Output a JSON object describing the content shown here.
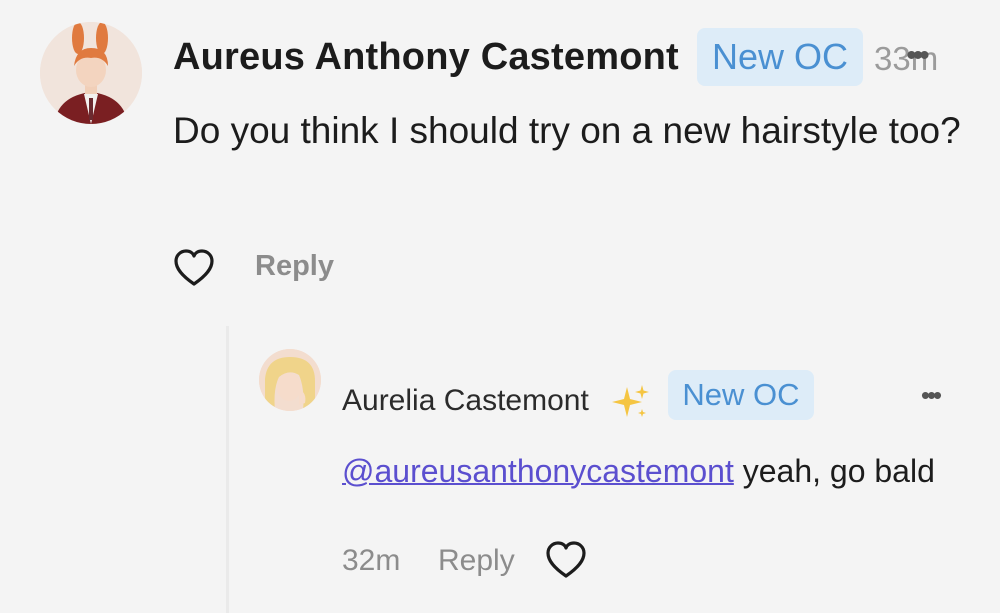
{
  "comment": {
    "author": "Aureus Anthony Castemont",
    "badge": "New OC",
    "time": "33m",
    "more": "•••",
    "text": "Do you think I should try on a new hairstyle too?",
    "reply_label": "Reply",
    "like_icon": "heart-outline-icon",
    "avatar_icon": "avatar-character-red-hair-bunny-ears"
  },
  "reply": {
    "author": "Aurelia Castemont",
    "emoji": "sparkles-icon",
    "badge": "New OC",
    "more": "•••",
    "mention": "@aureusanthonycastemont",
    "text": " yeah, go bald",
    "time": "32m",
    "reply_label": "Reply",
    "like_icon": "heart-outline-icon",
    "avatar_icon": "avatar-character-blonde-hair"
  },
  "colors": {
    "background": "#f4f4f4",
    "badge_bg": "#ddecf8",
    "badge_text": "#4a90d2",
    "mention": "#5b4fcf",
    "muted": "#8c8c8c"
  }
}
